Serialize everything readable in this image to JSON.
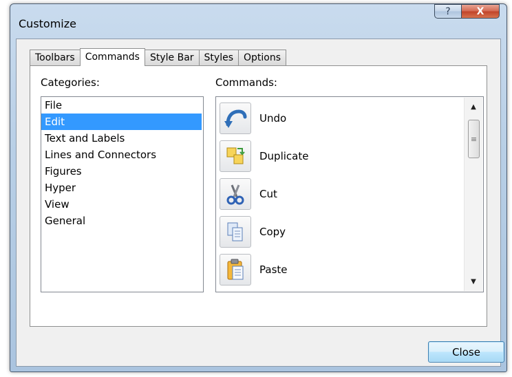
{
  "window": {
    "title": "Customize",
    "help_glyph": "?",
    "close_glyph": "X"
  },
  "tabs": [
    {
      "label": "Toolbars",
      "active": false
    },
    {
      "label": "Commands",
      "active": true
    },
    {
      "label": "Style Bar",
      "active": false
    },
    {
      "label": "Styles",
      "active": false
    },
    {
      "label": "Options",
      "active": false
    }
  ],
  "categories": {
    "label": "Categories:",
    "items": [
      "File",
      "Edit",
      "Text and Labels",
      "Lines and Connectors",
      "Figures",
      "Hyper",
      "View",
      "General"
    ],
    "selected": "Edit"
  },
  "commands": {
    "label": "Commands:",
    "items": [
      {
        "label": "Undo",
        "icon": "undo-icon"
      },
      {
        "label": "Duplicate",
        "icon": "duplicate-icon"
      },
      {
        "label": "Cut",
        "icon": "scissors-icon"
      },
      {
        "label": "Copy",
        "icon": "copy-icon"
      },
      {
        "label": "Paste",
        "icon": "clipboard-icon"
      }
    ],
    "scroll_up_glyph": "▲",
    "scroll_down_glyph": "▼",
    "thumb_grip_glyph": "≡"
  },
  "footer": {
    "close_label": "Close"
  },
  "colors": {
    "selection": "#3399ff",
    "title_close_red": "#c0432a"
  }
}
